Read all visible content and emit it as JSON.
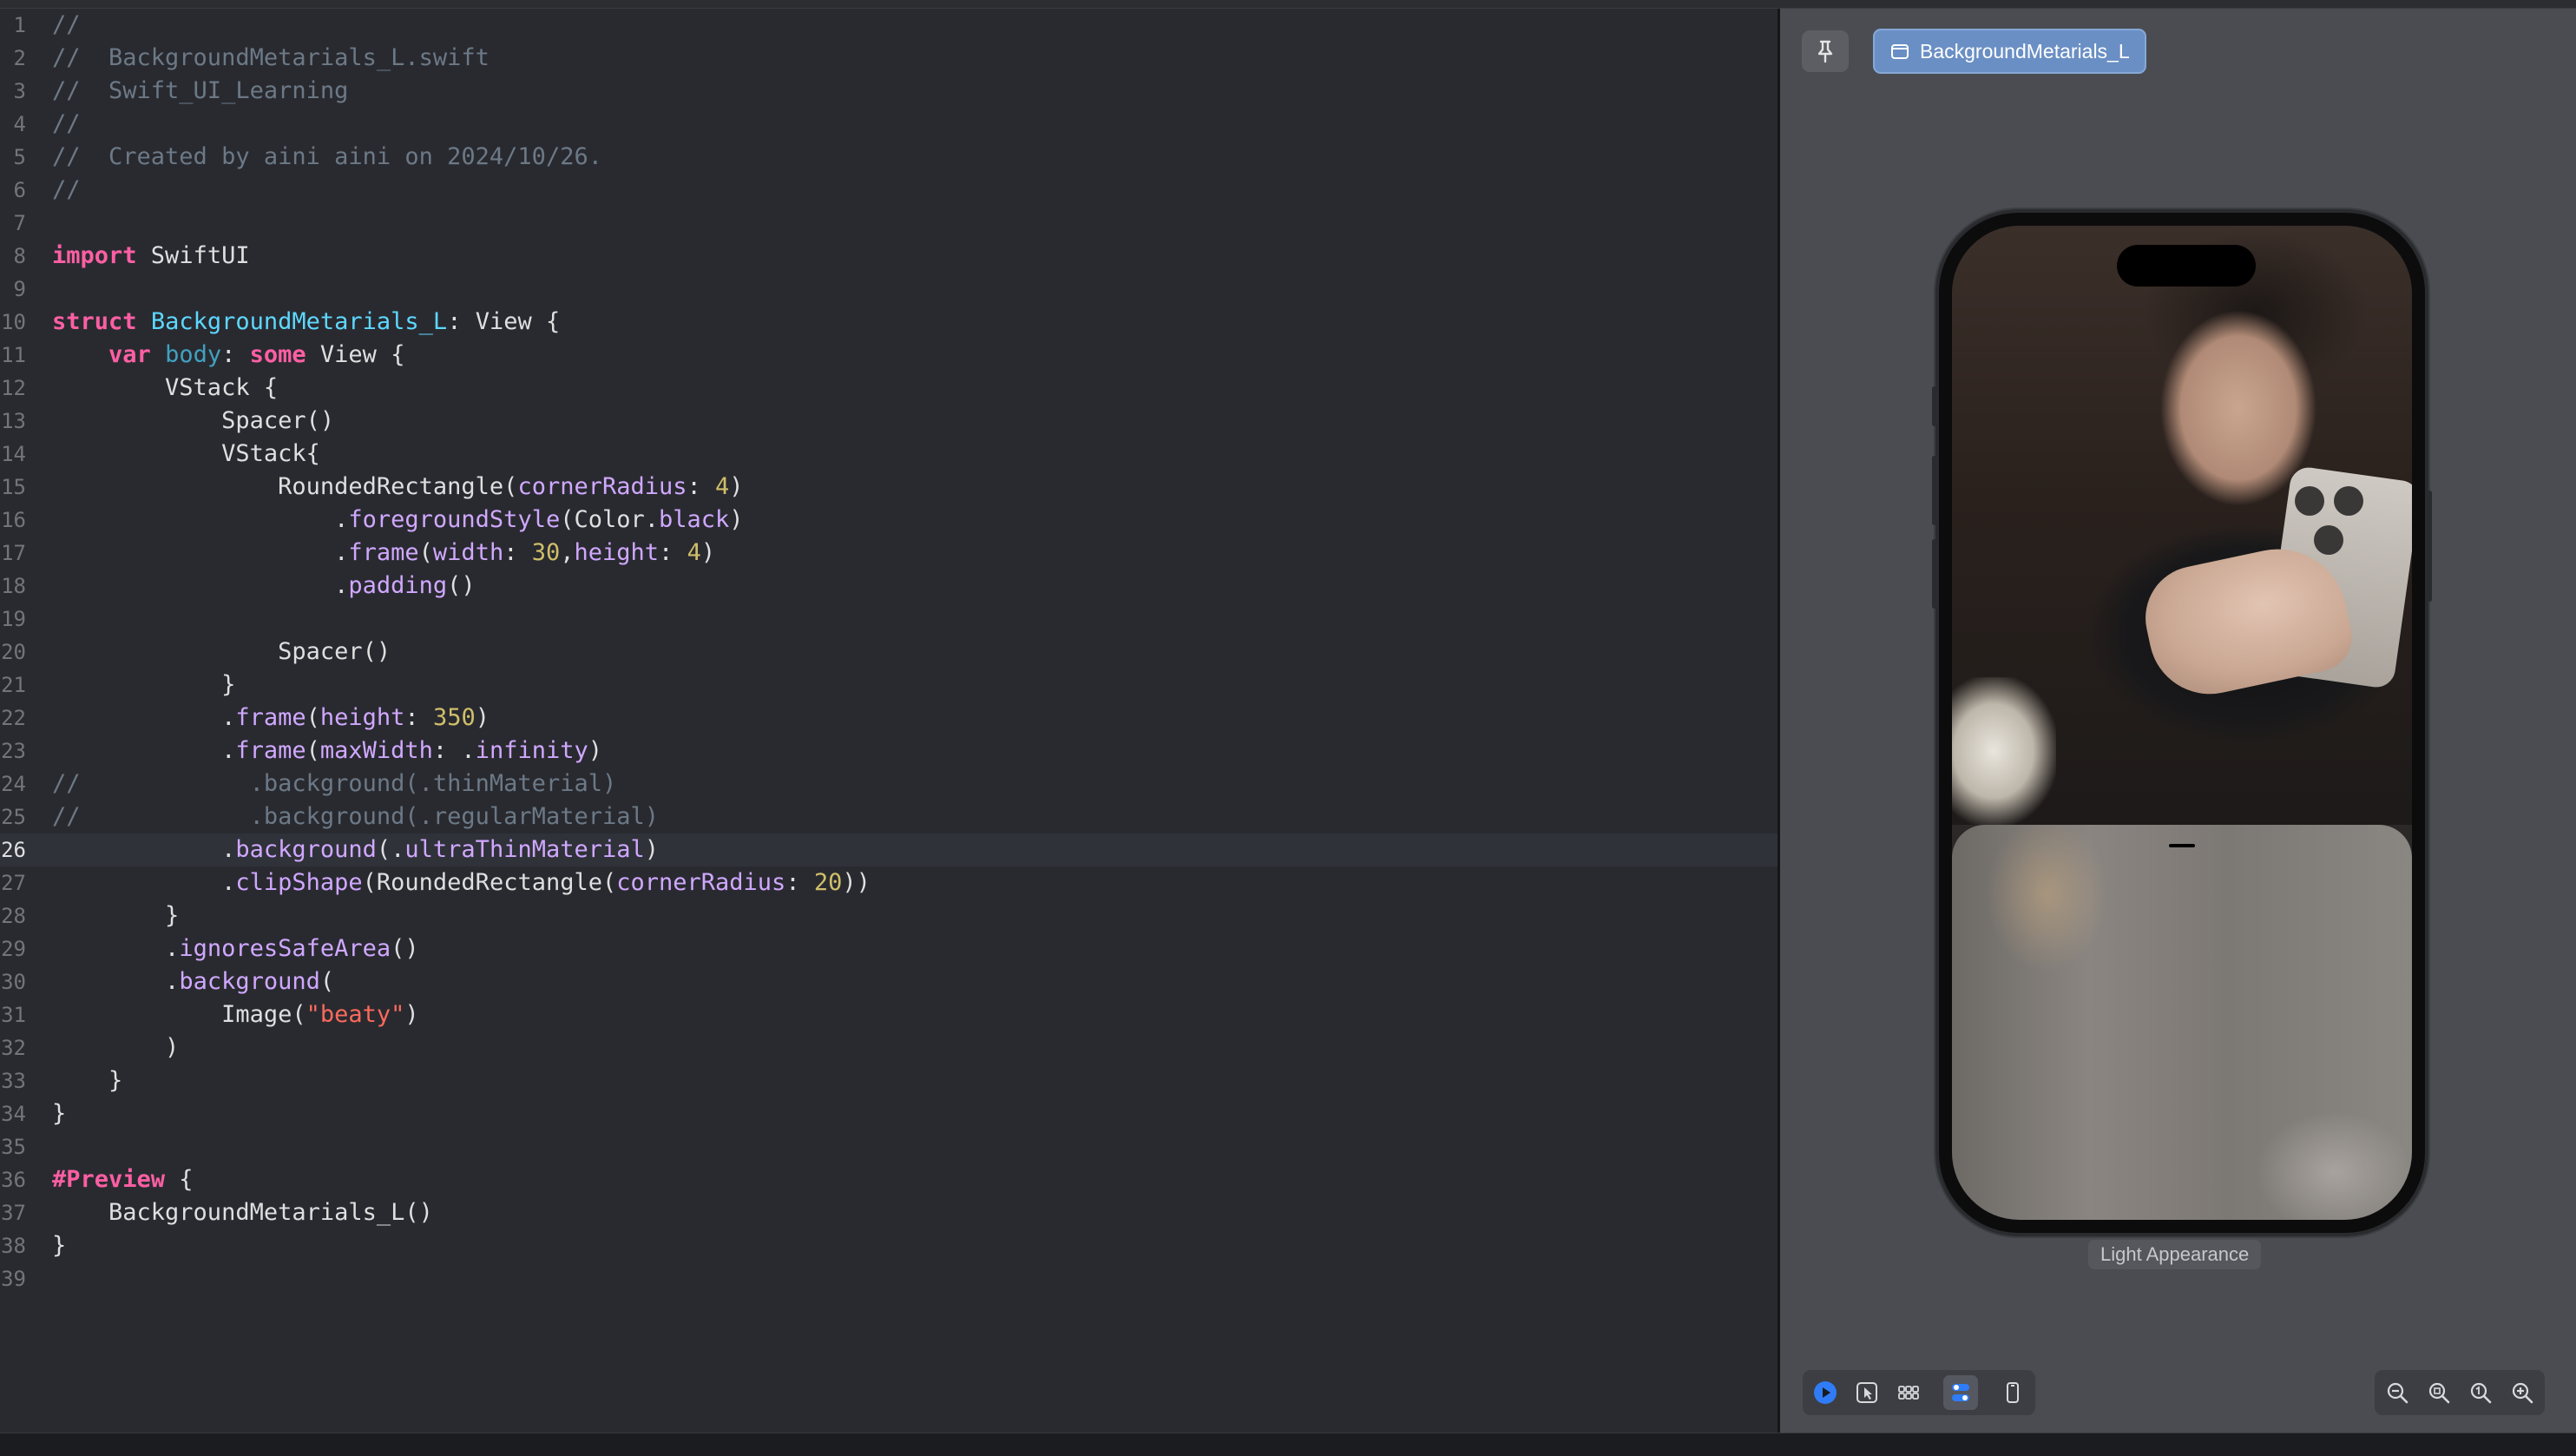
{
  "editor": {
    "current_line": 26,
    "lines": [
      {
        "n": "1",
        "segs": [
          [
            "cm",
            "//"
          ]
        ]
      },
      {
        "n": "2",
        "segs": [
          [
            "cm",
            "//  BackgroundMetarials_L.swift"
          ]
        ]
      },
      {
        "n": "3",
        "segs": [
          [
            "cm",
            "//  Swift_UI_Learning"
          ]
        ]
      },
      {
        "n": "4",
        "segs": [
          [
            "cm",
            "//"
          ]
        ]
      },
      {
        "n": "5",
        "segs": [
          [
            "cm",
            "//  Created by aini aini on 2024/10/26."
          ]
        ]
      },
      {
        "n": "6",
        "segs": [
          [
            "cm",
            "//"
          ]
        ]
      },
      {
        "n": "7",
        "segs": []
      },
      {
        "n": "8",
        "segs": [
          [
            "kw",
            "import"
          ],
          [
            "pl",
            " SwiftUI"
          ]
        ]
      },
      {
        "n": "9",
        "segs": []
      },
      {
        "n": "10",
        "segs": [
          [
            "kw",
            "struct"
          ],
          [
            "pl",
            " "
          ],
          [
            "tp",
            "BackgroundMetarials_L"
          ],
          [
            "pl",
            ": View {"
          ]
        ]
      },
      {
        "n": "11",
        "segs": [
          [
            "pl",
            "    "
          ],
          [
            "kw",
            "var"
          ],
          [
            "pl",
            " "
          ],
          [
            "id",
            "body"
          ],
          [
            "pl",
            ": "
          ],
          [
            "kw",
            "some"
          ],
          [
            "pl",
            " View {"
          ]
        ]
      },
      {
        "n": "12",
        "segs": [
          [
            "pl",
            "        VStack {"
          ]
        ]
      },
      {
        "n": "13",
        "segs": [
          [
            "pl",
            "            Spacer()"
          ]
        ]
      },
      {
        "n": "14",
        "segs": [
          [
            "pl",
            "            VStack{"
          ]
        ]
      },
      {
        "n": "15",
        "segs": [
          [
            "pl",
            "                RoundedRectangle("
          ],
          [
            "fn",
            "cornerRadius"
          ],
          [
            "pl",
            ": "
          ],
          [
            "nm",
            "4"
          ],
          [
            "pl",
            ")"
          ]
        ]
      },
      {
        "n": "16",
        "segs": [
          [
            "pl",
            "                    ."
          ],
          [
            "fn",
            "foregroundStyle"
          ],
          [
            "pl",
            "(Color."
          ],
          [
            "fn",
            "black"
          ],
          [
            "pl",
            ")"
          ]
        ]
      },
      {
        "n": "17",
        "segs": [
          [
            "pl",
            "                    ."
          ],
          [
            "fn",
            "frame"
          ],
          [
            "pl",
            "("
          ],
          [
            "fn",
            "width"
          ],
          [
            "pl",
            ": "
          ],
          [
            "nm",
            "30"
          ],
          [
            "pl",
            ","
          ],
          [
            "fn",
            "height"
          ],
          [
            "pl",
            ": "
          ],
          [
            "nm",
            "4"
          ],
          [
            "pl",
            ")"
          ]
        ]
      },
      {
        "n": "18",
        "segs": [
          [
            "pl",
            "                    ."
          ],
          [
            "fn",
            "padding"
          ],
          [
            "pl",
            "()"
          ]
        ]
      },
      {
        "n": "19",
        "segs": []
      },
      {
        "n": "20",
        "segs": [
          [
            "pl",
            "                Spacer()"
          ]
        ]
      },
      {
        "n": "21",
        "segs": [
          [
            "pl",
            "            }"
          ]
        ]
      },
      {
        "n": "22",
        "segs": [
          [
            "pl",
            "            ."
          ],
          [
            "fn",
            "frame"
          ],
          [
            "pl",
            "("
          ],
          [
            "fn",
            "height"
          ],
          [
            "pl",
            ": "
          ],
          [
            "nm",
            "350"
          ],
          [
            "pl",
            ")"
          ]
        ]
      },
      {
        "n": "23",
        "segs": [
          [
            "pl",
            "            ."
          ],
          [
            "fn",
            "frame"
          ],
          [
            "pl",
            "("
          ],
          [
            "fn",
            "maxWidth"
          ],
          [
            "pl",
            ": ."
          ],
          [
            "fn",
            "infinity"
          ],
          [
            "pl",
            ")"
          ]
        ]
      },
      {
        "n": "24",
        "segs": [
          [
            "cm",
            "//            .background(.thinMaterial)"
          ]
        ]
      },
      {
        "n": "25",
        "segs": [
          [
            "cm",
            "//            .background(.regularMaterial)"
          ]
        ]
      },
      {
        "n": "26",
        "segs": [
          [
            "pl",
            "            ."
          ],
          [
            "fn",
            "background"
          ],
          [
            "pl",
            "(."
          ],
          [
            "fn",
            "ultraThinMaterial"
          ],
          [
            "pl",
            ")"
          ]
        ]
      },
      {
        "n": "27",
        "segs": [
          [
            "pl",
            "            ."
          ],
          [
            "fn",
            "clipShape"
          ],
          [
            "pl",
            "(RoundedRectangle("
          ],
          [
            "fn",
            "cornerRadius"
          ],
          [
            "pl",
            ": "
          ],
          [
            "nm",
            "20"
          ],
          [
            "pl",
            "))"
          ]
        ]
      },
      {
        "n": "28",
        "segs": [
          [
            "pl",
            "        }"
          ]
        ]
      },
      {
        "n": "29",
        "segs": [
          [
            "pl",
            "        ."
          ],
          [
            "fn",
            "ignoresSafeArea"
          ],
          [
            "pl",
            "()"
          ]
        ]
      },
      {
        "n": "30",
        "segs": [
          [
            "pl",
            "        ."
          ],
          [
            "fn",
            "background"
          ],
          [
            "pl",
            "("
          ]
        ]
      },
      {
        "n": "31",
        "segs": [
          [
            "pl",
            "            Image("
          ],
          [
            "st",
            "\"beaty\""
          ],
          [
            "pl",
            ")"
          ]
        ]
      },
      {
        "n": "32",
        "segs": [
          [
            "pl",
            "        )"
          ]
        ]
      },
      {
        "n": "33",
        "segs": [
          [
            "pl",
            "    }"
          ]
        ]
      },
      {
        "n": "34",
        "segs": [
          [
            "pl",
            "}"
          ]
        ]
      },
      {
        "n": "35",
        "segs": []
      },
      {
        "n": "36",
        "segs": [
          [
            "kw",
            "#Preview"
          ],
          [
            "pl",
            " {"
          ]
        ]
      },
      {
        "n": "37",
        "segs": [
          [
            "pl",
            "    BackgroundMetarials_L()"
          ]
        ]
      },
      {
        "n": "38",
        "segs": [
          [
            "pl",
            "}"
          ]
        ]
      },
      {
        "n": "39",
        "segs": []
      }
    ]
  },
  "preview": {
    "pin_icon": "pin-icon",
    "tab_label": "BackgroundMetarials_L",
    "tab_icon": "preview-window-icon",
    "appearance_label": "Light Appearance",
    "toolbar_left": [
      "live-play-icon",
      "select-pointer-icon",
      "variants-grid-icon",
      "device-settings-icon",
      "device-icon"
    ],
    "toolbar_right": [
      "zoom-out-icon",
      "zoom-to-fit-icon",
      "zoom-100-icon",
      "zoom-in-icon"
    ]
  },
  "colors": {
    "editor_bg": "#292a30",
    "keyword": "#fc5fa3",
    "comment": "#6c7986",
    "type_decl": "#5dd8ff",
    "identifier": "#41a1c0",
    "member": "#d0a8ff",
    "number": "#d0bf69",
    "string": "#fc6a5d",
    "plain": "#dfdfe0",
    "accent": "#2f7cf6"
  }
}
